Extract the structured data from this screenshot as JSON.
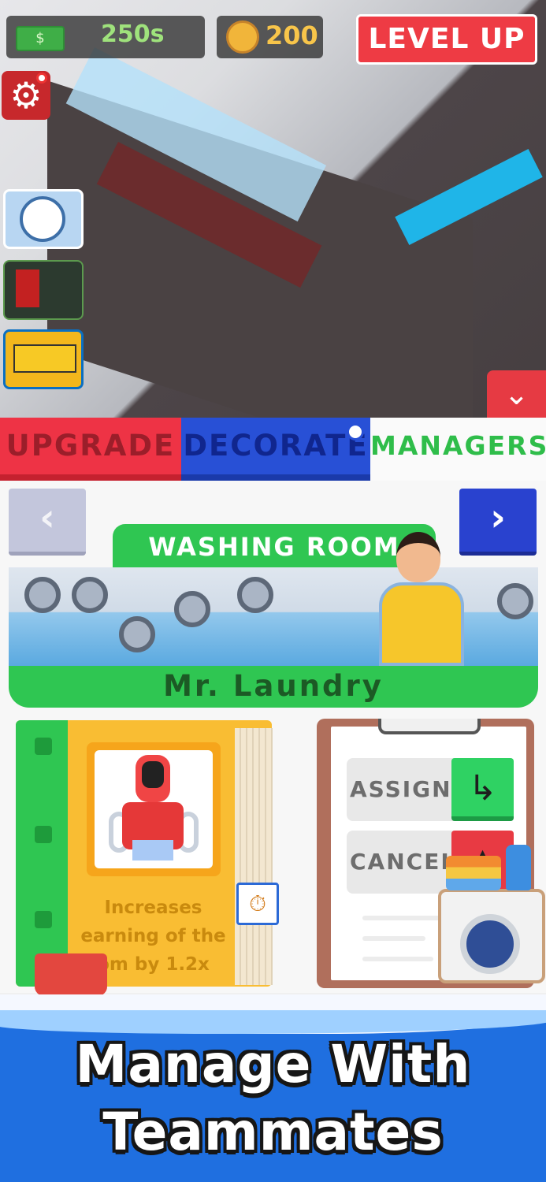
{
  "hud": {
    "cash_icon": "cash-icon",
    "cash_label": "$",
    "cash_value": "250s",
    "coin_icon": "coin-icon",
    "coin_value": "200",
    "level_up_label": "LEVEL UP"
  },
  "side_menu": {
    "settings_icon": "gear-icon",
    "settings_glyph": "⚙",
    "items": [
      "washing-machine-timer-icon",
      "parking-gate-icon",
      "school-bus-icon"
    ]
  },
  "collapse_glyph": "⌄",
  "tabs": [
    {
      "label": "UPGRADE",
      "active": false,
      "color": "#ee3345"
    },
    {
      "label": "DECORATE",
      "active": false,
      "color": "#2850d6"
    },
    {
      "label": "MANAGERS",
      "active": true,
      "color": "#2fbd4a"
    }
  ],
  "manager_panel": {
    "prev_glyph": "‹",
    "next_glyph": "›",
    "room_title": "WASHING ROOM",
    "manager_name": "Mr. Laundry",
    "perk_text": "Increases earning of the room by 1.2x",
    "perk_line_1": "Increases",
    "perk_line_2": "earning of the",
    "perk_line_3": "om by 1.2x",
    "timer_glyph": "⏱",
    "actions": {
      "assign_label": "ASSIGN",
      "assign_glyph": "↳",
      "cancel_label": "CANCEL",
      "cancel_glyph": "▲"
    }
  },
  "promo": {
    "line1": "Manage With",
    "line2": "Teammates"
  },
  "colors": {
    "accent_green": "#2fc652",
    "accent_red": "#ee3b44",
    "accent_blue": "#2942cf",
    "folder_yellow": "#f9bd33"
  }
}
